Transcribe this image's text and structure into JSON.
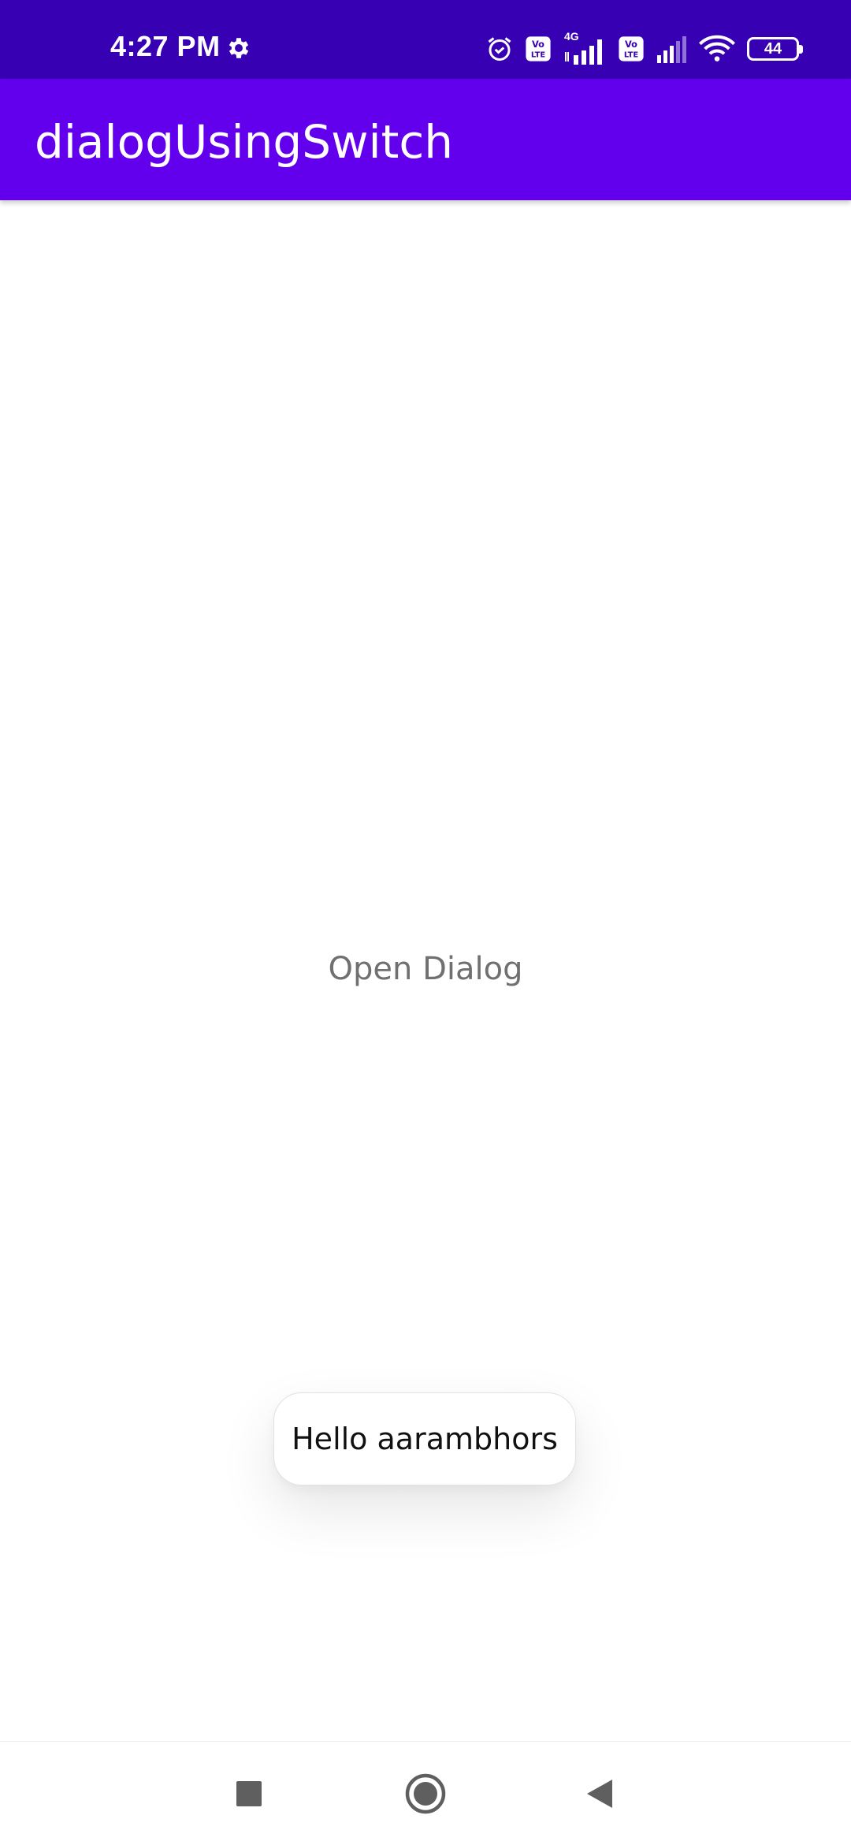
{
  "status_bar": {
    "time": "4:27 PM",
    "battery_level": "44",
    "network_label": "4G",
    "icons": [
      "settings-gear-icon",
      "alarm-icon",
      "volte-icon",
      "signal-icon",
      "volte-icon",
      "signal-icon",
      "wifi-icon",
      "battery-icon"
    ]
  },
  "app_bar": {
    "title": "dialogUsingSwitch",
    "color": "#6200ee",
    "status_color": "#3700b3"
  },
  "main": {
    "open_dialog_label": "Open Dialog"
  },
  "toast": {
    "message": "Hello aarambhors"
  },
  "nav_bar": {
    "icons": [
      "recents-square-icon",
      "home-circle-icon",
      "back-triangle-icon"
    ]
  }
}
